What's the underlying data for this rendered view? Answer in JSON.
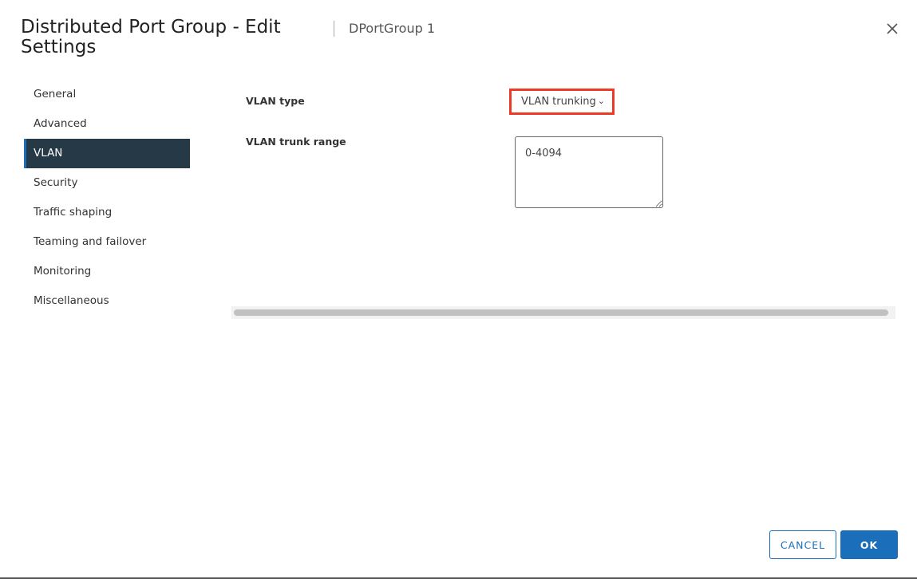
{
  "dialog": {
    "title": "Distributed Port Group - Edit Settings",
    "subtitle": "DPortGroup 1",
    "close_icon": "close-icon"
  },
  "sidebar": {
    "items": [
      {
        "label": "General"
      },
      {
        "label": "Advanced"
      },
      {
        "label": "VLAN",
        "active": true
      },
      {
        "label": "Security"
      },
      {
        "label": "Traffic shaping"
      },
      {
        "label": "Teaming and failover"
      },
      {
        "label": "Monitoring"
      },
      {
        "label": "Miscellaneous"
      }
    ]
  },
  "form": {
    "vlan_type_label": "VLAN type",
    "vlan_type_value": "VLAN trunking",
    "vlan_trunk_range_label": "VLAN trunk range",
    "vlan_trunk_range_value": "0-4094",
    "highlight_color": "#ee3a24"
  },
  "footer": {
    "cancel_label": "CANCEL",
    "ok_label": "OK"
  },
  "colors": {
    "accent": "#1b6fba",
    "nav_active_bg": "#263947"
  }
}
